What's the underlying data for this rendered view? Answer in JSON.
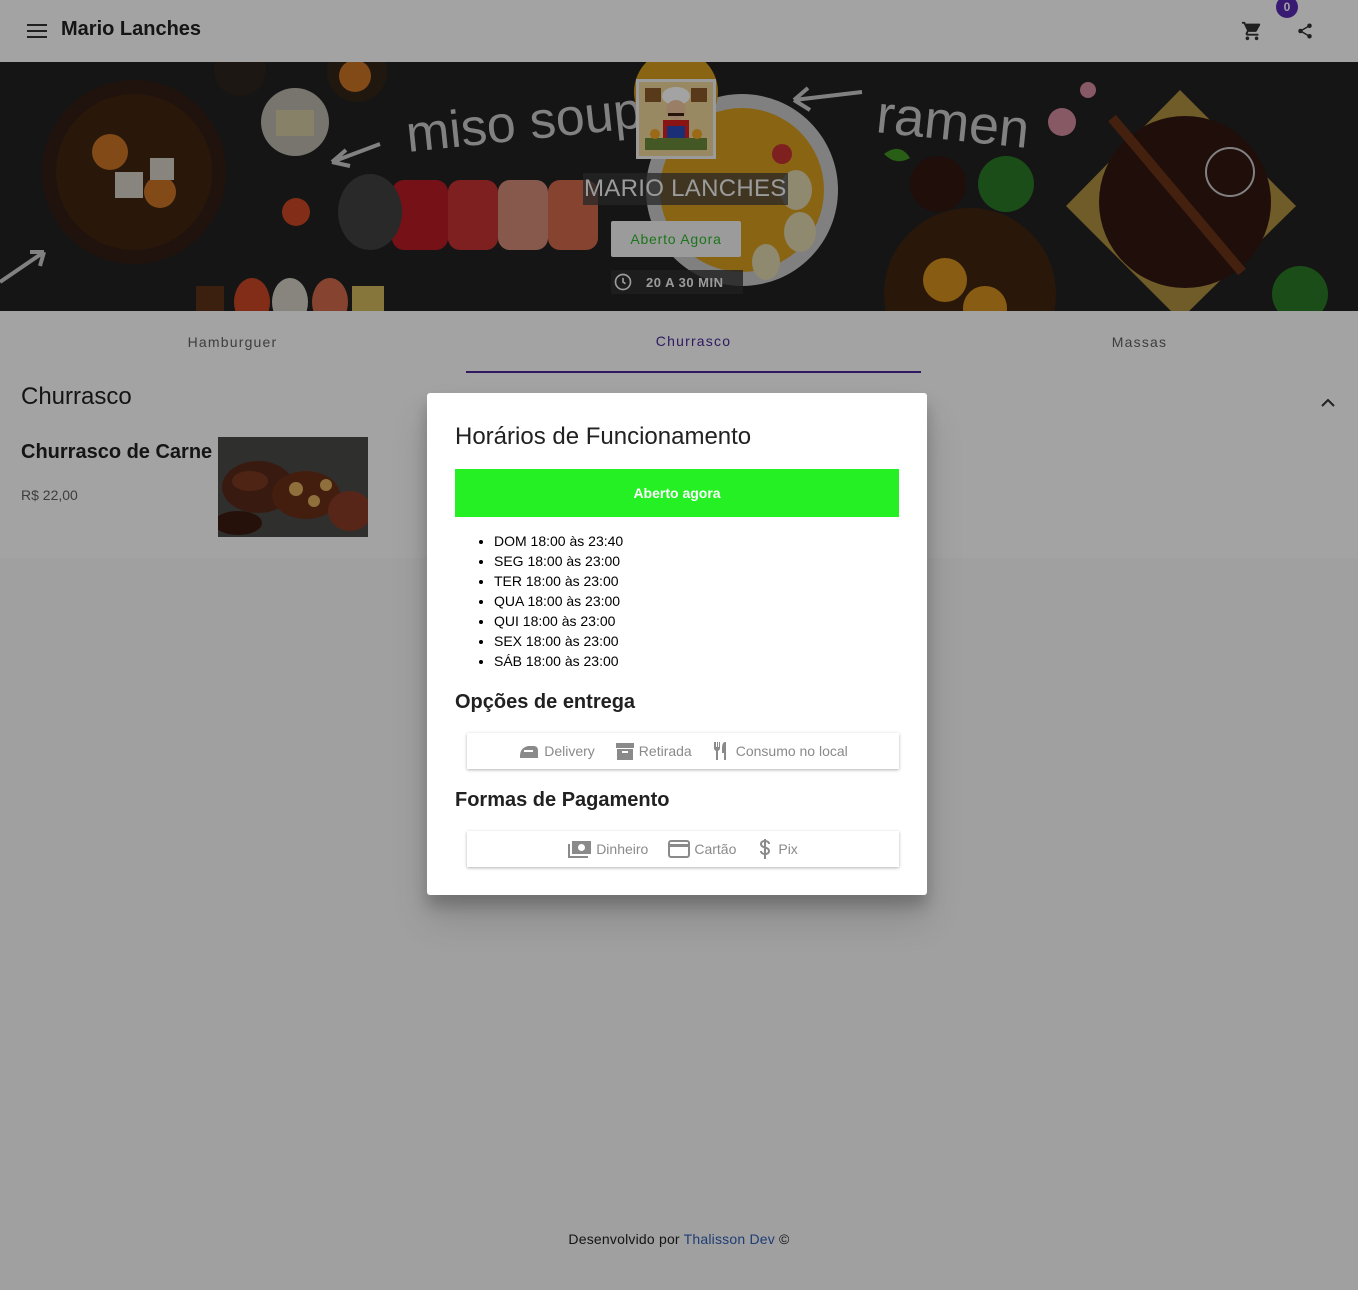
{
  "app": {
    "title": "Mario Lanches",
    "cart_count": "0"
  },
  "store": {
    "name": "MARIO LANCHES",
    "status_button": "Aberto Agora",
    "delivery_time": "20 A 30 MIN"
  },
  "hero_art_text": {
    "left": "miso soup",
    "right": "ramen"
  },
  "tabs": [
    {
      "label": "Hamburguer"
    },
    {
      "label": "Churrasco"
    },
    {
      "label": "Massas"
    }
  ],
  "section": {
    "title": "Churrasco",
    "product": {
      "name": "Churrasco de Carne",
      "price": "R$ 22,00"
    }
  },
  "footer": {
    "prefix": "Desenvolvido por",
    "author": "Thalisson Dev",
    "suffix": "©"
  },
  "dialog": {
    "title": "Horários de Funcionamento",
    "status": "Aberto agora",
    "hours": [
      "DOM 18:00 às 23:40",
      "SEG 18:00 às 23:00",
      "TER 18:00 às 23:00",
      "QUA 18:00 às 23:00",
      "QUI 18:00 às 23:00",
      "SEX 18:00 às 23:00",
      "SÁB 18:00 às 23:00"
    ],
    "delivery_heading": "Opções de entrega",
    "delivery_options": [
      {
        "label": "Delivery",
        "icon": "delivery-icon"
      },
      {
        "label": "Retirada",
        "icon": "box-icon"
      },
      {
        "label": "Consumo no local",
        "icon": "restaurant-icon"
      }
    ],
    "payment_heading": "Formas de Pagamento",
    "payment_options": [
      {
        "label": "Dinheiro",
        "icon": "cash-icon"
      },
      {
        "label": "Cartão",
        "icon": "credit-card-icon"
      },
      {
        "label": "Pix",
        "icon": "dollar-icon"
      }
    ]
  },
  "colors": {
    "accent": "#4a2a9a",
    "status_green": "#24f024",
    "open_text": "#2db82d",
    "link": "#2f5fb8"
  }
}
